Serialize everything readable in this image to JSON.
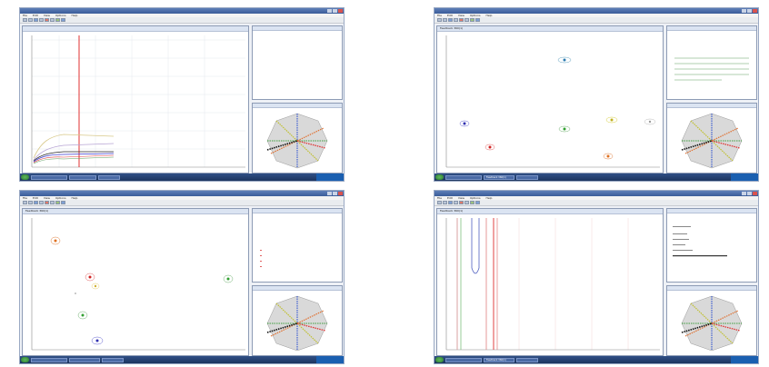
{
  "screenshots": [
    {
      "title": "",
      "menus": [
        "File",
        "Edit",
        "View",
        "Options",
        "Help"
      ],
      "main_title": "",
      "side_top_title": "",
      "side_bottom_title": "",
      "status": "",
      "tray": "",
      "task_buttons": [
        "",
        "",
        ""
      ],
      "info_lines": []
    },
    {
      "title": "",
      "menus": [
        "File",
        "Edit",
        "View",
        "Options",
        "Help"
      ],
      "main_title": "Feedback 360(1)",
      "side_top_title": "",
      "side_bottom_title": "",
      "status": "",
      "tray": "",
      "task_buttons": [
        "",
        "Feedback 360(1)",
        ""
      ],
      "info_lines": []
    },
    {
      "title": "",
      "menus": [
        "File",
        "Edit",
        "View",
        "Options",
        "Help"
      ],
      "main_title": "Feedback 360(1)",
      "side_top_title": "",
      "side_bottom_title": "",
      "status": "",
      "tray": "",
      "task_buttons": [
        "",
        "",
        ""
      ],
      "info_lines": []
    },
    {
      "title": "",
      "menus": [
        "File",
        "Edit",
        "View",
        "Options",
        "Help"
      ],
      "main_title": "Feedback 360(1)",
      "side_top_title": "",
      "side_bottom_title": "",
      "status": "",
      "tray": "",
      "task_buttons": [
        "",
        "Feedback 360(1)",
        ""
      ],
      "info_lines": []
    }
  ],
  "colors": {
    "accent": "#3a5c99",
    "close": "#d9534f",
    "cursor": "#e03030"
  }
}
